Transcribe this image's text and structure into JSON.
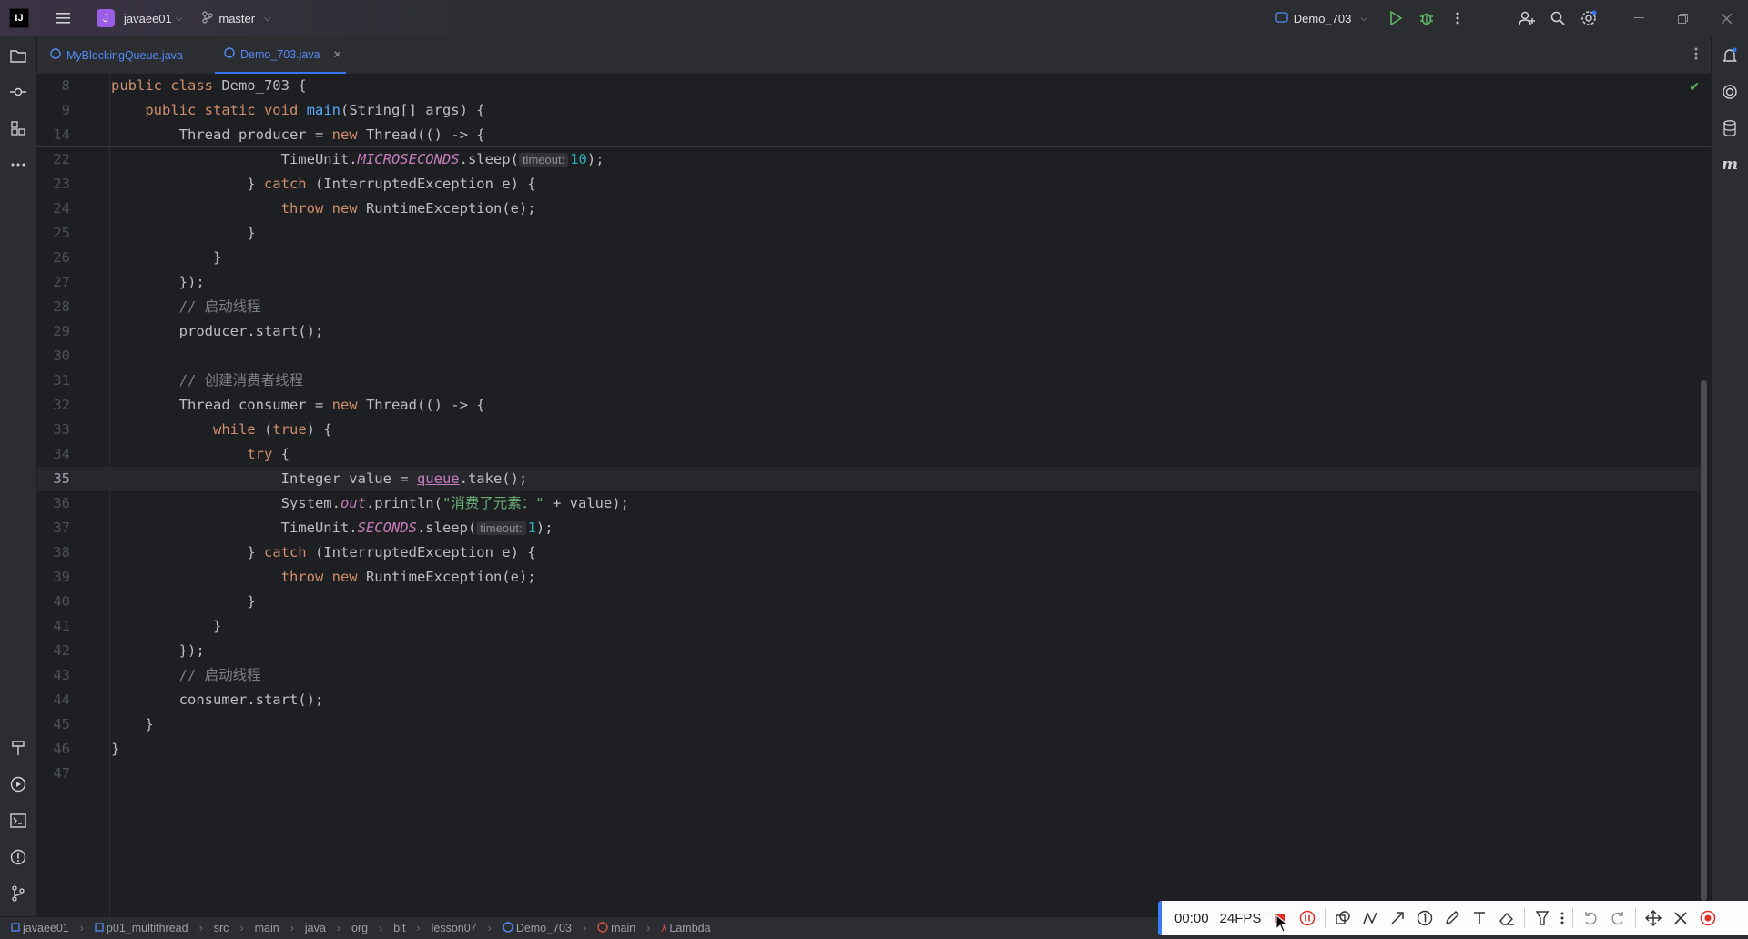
{
  "titlebar": {
    "app_logo": "IJ",
    "project_initial": "J",
    "project_name": "javaee01",
    "branch": "master",
    "run_config": "Demo_703"
  },
  "tabs": [
    {
      "label": "MyBlockingQueue.java",
      "active": false
    },
    {
      "label": "Demo_703.java",
      "active": true
    }
  ],
  "editor": {
    "lines": [
      {
        "n": "8",
        "html": "<span class=\"kw\">public class</span> Demo_703 {"
      },
      {
        "n": "9",
        "html": "    <span class=\"kw\">public static void</span> <span class=\"fn\">main</span>(String[] args) {"
      },
      {
        "n": "14",
        "html": "        Thread producer = <span class=\"kw\">new</span> Thread(() -> {"
      },
      {
        "n": "22",
        "html": "                    TimeUnit.<span class=\"stat\">MICROSECONDS</span>.sleep(<span class=\"hint\">timeout:</span><span class=\"num\">10</span>);"
      },
      {
        "n": "23",
        "html": "                } <span class=\"kw\">catch</span> (InterruptedException e) {"
      },
      {
        "n": "24",
        "html": "                    <span class=\"kw\">throw new</span> RuntimeException(e);"
      },
      {
        "n": "25",
        "html": "                }"
      },
      {
        "n": "26",
        "html": "            }"
      },
      {
        "n": "27",
        "html": "        });"
      },
      {
        "n": "28",
        "html": "        <span class=\"cmt\">// 启动线程</span>"
      },
      {
        "n": "29",
        "html": "        producer.start();"
      },
      {
        "n": "30",
        "html": ""
      },
      {
        "n": "31",
        "html": "        <span class=\"cmt\">// 创建消费者线程</span>"
      },
      {
        "n": "32",
        "html": "        Thread consumer = <span class=\"kw\">new</span> Thread(() -> {"
      },
      {
        "n": "33",
        "html": "            <span class=\"kw\">while</span> (<span class=\"kw\">true</span>) {"
      },
      {
        "n": "34",
        "html": "                <span class=\"kw\">try</span> {"
      },
      {
        "n": "35",
        "html": "                    Integer value = <span class=\"field\">queue</span>.take();",
        "current": true
      },
      {
        "n": "36",
        "html": "                    System.<span class=\"stat\">out</span>.println(<span class=\"str\">\"消费了元素：\"</span> + value);"
      },
      {
        "n": "37",
        "html": "                    TimeUnit.<span class=\"stat\">SECONDS</span>.sleep(<span class=\"hint\">timeout:</span><span class=\"num\">1</span>);"
      },
      {
        "n": "38",
        "html": "                } <span class=\"kw\">catch</span> (InterruptedException e) {"
      },
      {
        "n": "39",
        "html": "                    <span class=\"kw\">throw new</span> RuntimeException(e);"
      },
      {
        "n": "40",
        "html": "                }"
      },
      {
        "n": "41",
        "html": "            }"
      },
      {
        "n": "42",
        "html": "        });"
      },
      {
        "n": "43",
        "html": "        <span class=\"cmt\">// 启动线程</span>"
      },
      {
        "n": "44",
        "html": "        consumer.start();"
      },
      {
        "n": "45",
        "html": "    }"
      },
      {
        "n": "46",
        "html": "}"
      },
      {
        "n": "47",
        "html": ""
      }
    ]
  },
  "statusbar": {
    "breadcrumbs": [
      "javaee01",
      "p01_multithread",
      "src",
      "main",
      "java",
      "org",
      "bit",
      "lesson07",
      "Demo_703",
      "main",
      "Lambda"
    ]
  },
  "recorder": {
    "time": "00:00",
    "fps": "24FPS"
  },
  "colors": {
    "accent": "#3574f0",
    "background": "#1e1f22",
    "panel": "#2b2d30"
  }
}
